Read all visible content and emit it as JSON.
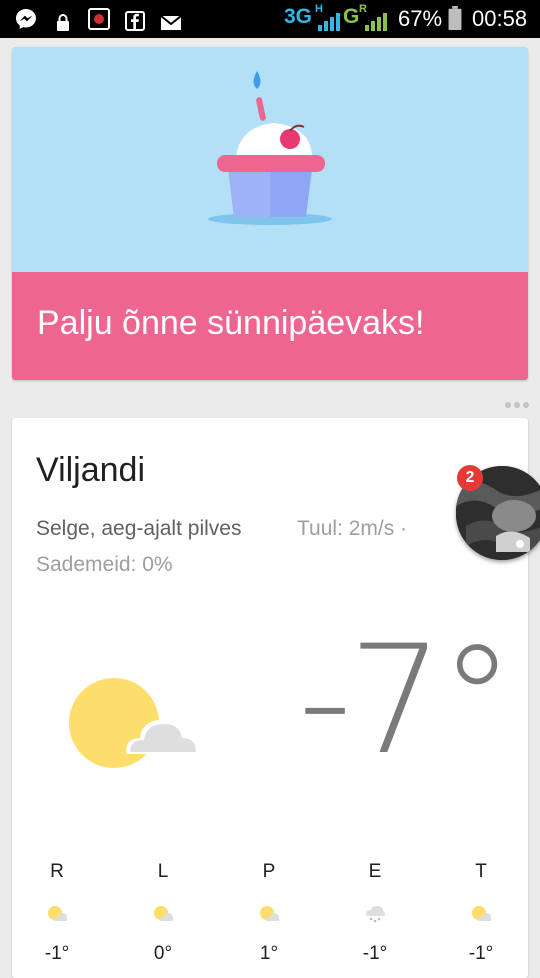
{
  "status_bar": {
    "network": "3G",
    "network_h": "H",
    "network2": "G",
    "network2_r": "R",
    "battery": "67%",
    "time": "00:58",
    "icons": [
      "messenger-icon",
      "lock-icon",
      "screen-record-icon",
      "facebook-icon",
      "gmail-icon",
      "signal-icon",
      "battery-icon"
    ]
  },
  "birthday_card": {
    "message": "Palju õnne sünnipäevaks!",
    "colors": {
      "sky": "#b3e0f7",
      "banner": "#ee6590"
    }
  },
  "weather_card": {
    "city": "Viljandi",
    "condition": "Selge, aeg-ajalt pilves",
    "wind": "Tuul: 2m/s ·",
    "precipitation": "Sademeid: 0%",
    "temperature": "-7°",
    "icon": "partly-cloudy-icon",
    "forecast": [
      {
        "day": "R",
        "icon": "partly-cloudy-icon",
        "temp": "-1°"
      },
      {
        "day": "L",
        "icon": "partly-cloudy-icon",
        "temp": "0°"
      },
      {
        "day": "P",
        "icon": "partly-cloudy-icon",
        "temp": "1°"
      },
      {
        "day": "E",
        "icon": "snow-icon",
        "temp": "-1°"
      },
      {
        "day": "T",
        "icon": "partly-cloudy-icon",
        "temp": "-1°"
      }
    ]
  },
  "chat_head": {
    "badge_count": "2"
  }
}
